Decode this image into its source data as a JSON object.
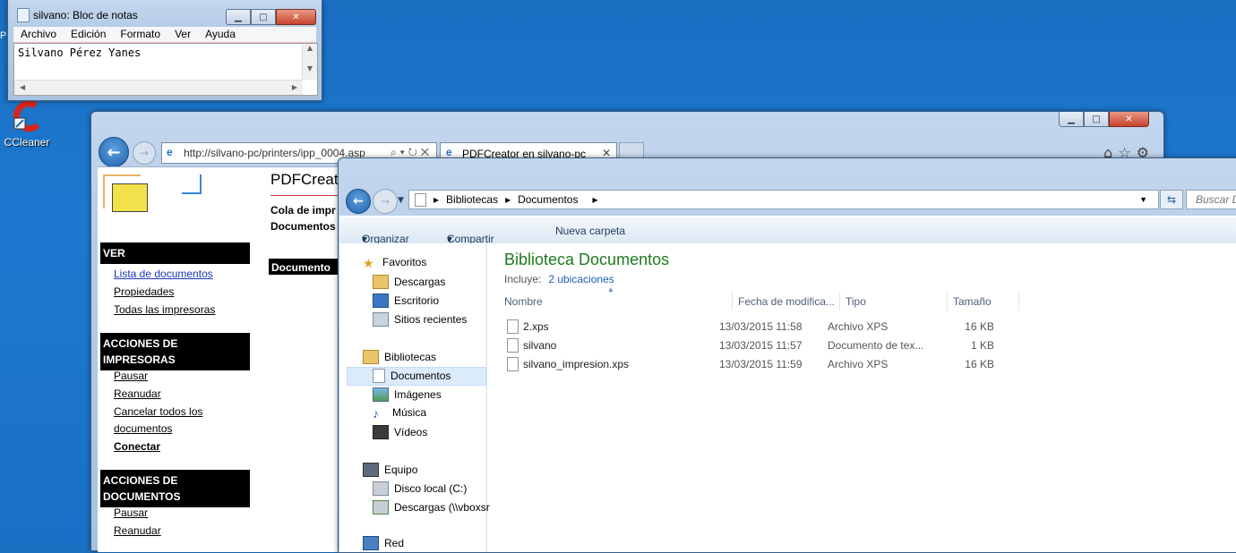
{
  "desktop": {
    "partial_label": "P",
    "icon_label": "CCleaner"
  },
  "notepad": {
    "title": "silvano: Bloc de notas",
    "menu": [
      "Archivo",
      "Edición",
      "Formato",
      "Ver",
      "Ayuda"
    ],
    "content": "Silvano Pérez Yanes"
  },
  "ie": {
    "url": "http://silvano-pc/printers/ipp_0004.asp",
    "tab_title": "PDFCreator en silvano-pc",
    "page_title": "PDFCreato",
    "queue_line1": "Cola de impr",
    "queue_line2": "Documentos",
    "doc_header": "Documento",
    "sections": [
      {
        "heading": "VER",
        "links": [
          {
            "label": "Lista de documentos"
          },
          {
            "label": "Propiedades"
          },
          {
            "label": "Todas las impresoras"
          }
        ]
      },
      {
        "heading_lines": [
          "ACCIONES DE",
          "IMPRESORAS"
        ],
        "links": [
          {
            "label": "Pausar"
          },
          {
            "label": "Reanudar"
          },
          {
            "label": "Cancelar todos los"
          },
          {
            "label": "documentos"
          },
          {
            "label": "Conectar"
          }
        ]
      },
      {
        "heading_lines": [
          "ACCIONES DE",
          "DOCUMENTOS"
        ],
        "links": [
          {
            "label": "Pausar"
          },
          {
            "label": "Reanudar"
          }
        ]
      }
    ]
  },
  "explorer": {
    "breadcrumb": [
      "Bibliotecas",
      "Documentos"
    ],
    "search_placeholder": "Buscar D",
    "toolbar": {
      "organize": "Organizar",
      "share": "Compartir con",
      "new_folder": "Nueva carpeta"
    },
    "nav": {
      "favorites": "Favoritos",
      "downloads": "Descargas",
      "desktop": "Escritorio",
      "recent": "Sitios recientes",
      "libraries": "Bibliotecas",
      "documents": "Documentos",
      "pictures": "Imágenes",
      "music": "Música",
      "videos": "Vídeos",
      "computer": "Equipo",
      "local_disk": "Disco local (C:)",
      "network_share": "Descargas (\\\\vboxsr",
      "partial": "Red"
    },
    "library_title": "Biblioteca Documentos",
    "includes_label": "Incluye:",
    "includes_link": "2 ubicaciones",
    "columns": [
      "Nombre",
      "Fecha de modifica...",
      "Tipo",
      "Tamaño"
    ],
    "files": [
      {
        "name": "2.xps",
        "date": "13/03/2015 11:58",
        "type": "Archivo XPS",
        "size": "16 KB"
      },
      {
        "name": "silvano",
        "date": "13/03/2015 11:57",
        "type": "Documento de tex...",
        "size": "1 KB"
      },
      {
        "name": "silvano_impresion.xps",
        "date": "13/03/2015 11:59",
        "type": "Archivo XPS",
        "size": "16 KB"
      }
    ]
  }
}
